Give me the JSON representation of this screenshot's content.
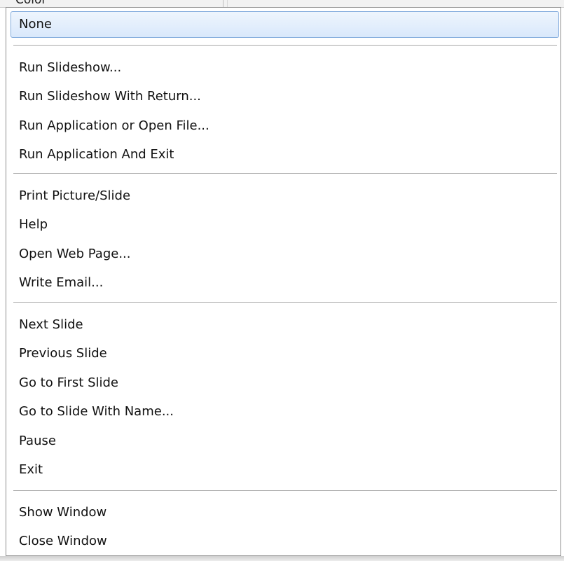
{
  "header": {
    "cut_label": "Color"
  },
  "menu": {
    "items": [
      "None",
      "Run Slideshow...",
      "Run Slideshow With Return...",
      "Run Application or Open File...",
      "Run Application And Exit",
      "Print Picture/Slide",
      "Help",
      "Open Web Page...",
      "Write Email...",
      "Next Slide",
      "Previous Slide",
      "Go to First Slide",
      "Go to Slide With Name...",
      "Pause",
      "Exit",
      "Show Window",
      "Close Window"
    ],
    "selected_label": "None"
  },
  "colors": {
    "selection_bg": "#d9e8fb",
    "selection_border": "#84acdd",
    "separator": "#a8a8a8"
  }
}
